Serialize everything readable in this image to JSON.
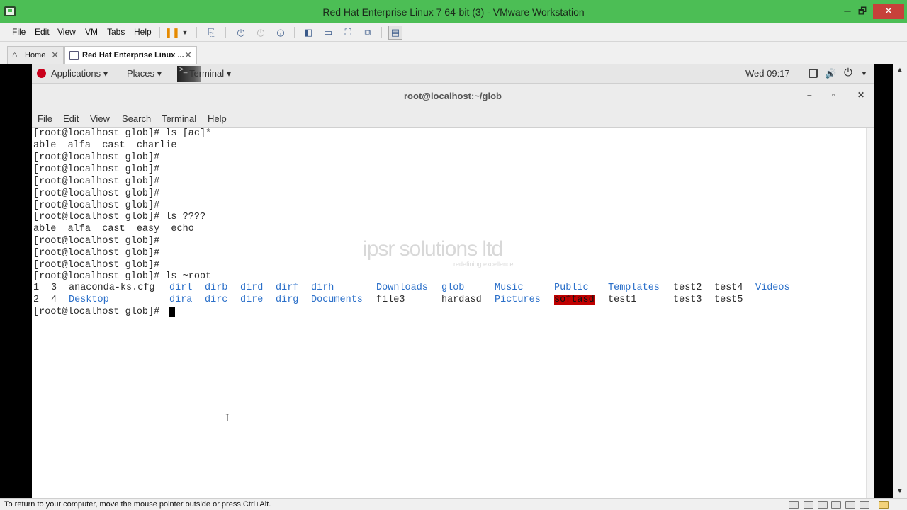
{
  "window": {
    "title": "Red Hat Enterprise Linux 7 64-bit (3) - VMware Workstation",
    "minimize": "─",
    "restore": "🗗",
    "close": "✕"
  },
  "vm_menu": [
    "File",
    "Edit",
    "View",
    "VM",
    "Tabs",
    "Help"
  ],
  "tabs": [
    {
      "label": "Home",
      "close": "✕"
    },
    {
      "label": "Red Hat Enterprise Linux ...",
      "close": "✕"
    }
  ],
  "gnome_panel": {
    "applications": "Applications ▾",
    "places": "Places ▾",
    "terminal": "Terminal ▾",
    "clock": "Wed 09:17",
    "icons": [
      "display-icon",
      "volume-icon",
      "power-icon"
    ]
  },
  "terminal": {
    "title": "root@localhost:~/glob",
    "min": "–",
    "max": "▫",
    "close": "✕",
    "menu": [
      "File",
      "Edit",
      "View",
      "Search",
      "Terminal",
      "Help"
    ],
    "lines": [
      "[root@localhost glob]# ls [ac]*",
      "able  alfa  cast  charlie",
      "[root@localhost glob]#",
      "[root@localhost glob]#",
      "[root@localhost glob]#",
      "[root@localhost glob]#",
      "[root@localhost glob]#",
      "[root@localhost glob]# ls ????",
      "able  alfa  cast  easy  echo",
      "[root@localhost glob]#",
      "[root@localhost glob]#",
      "[root@localhost glob]#",
      "[root@localhost glob]# ls ~root"
    ],
    "listing_row1": [
      {
        "t": "1",
        "k": "file"
      },
      {
        "t": "3",
        "k": "file"
      },
      {
        "t": "anaconda-ks.cfg",
        "k": "file"
      },
      {
        "t": "dirl",
        "k": "dir"
      },
      {
        "t": "dirb",
        "k": "dir"
      },
      {
        "t": "dird",
        "k": "dir"
      },
      {
        "t": "dirf",
        "k": "dir"
      },
      {
        "t": "dirh",
        "k": "dir"
      },
      {
        "t": "Downloads",
        "k": "dir"
      },
      {
        "t": "glob",
        "k": "dir"
      },
      {
        "t": "Music",
        "k": "dir"
      },
      {
        "t": "Public",
        "k": "dir"
      },
      {
        "t": "Templates",
        "k": "dir"
      },
      {
        "t": "test2",
        "k": "file"
      },
      {
        "t": "test4",
        "k": "file"
      },
      {
        "t": "Videos",
        "k": "dir"
      }
    ],
    "listing_row2": [
      {
        "t": "2",
        "k": "file"
      },
      {
        "t": "4",
        "k": "file"
      },
      {
        "t": "Desktop",
        "k": "dir"
      },
      {
        "t": "dira",
        "k": "dir"
      },
      {
        "t": "dirc",
        "k": "dir"
      },
      {
        "t": "dire",
        "k": "dir"
      },
      {
        "t": "dirg",
        "k": "dir"
      },
      {
        "t": "Documents",
        "k": "dir"
      },
      {
        "t": "file3",
        "k": "file"
      },
      {
        "t": "hardasd",
        "k": "file"
      },
      {
        "t": "Pictures",
        "k": "dir"
      },
      {
        "t": "softasd",
        "k": "warn"
      },
      {
        "t": "test1",
        "k": "file"
      },
      {
        "t": "test3",
        "k": "file"
      },
      {
        "t": "test5",
        "k": "file"
      }
    ],
    "prompt": "[root@localhost glob]# "
  },
  "watermark": {
    "text": "ipsr solutions ltd",
    "tagline": "redefining excellence"
  },
  "status": {
    "text": "To return to your computer, move the mouse pointer outside or press Ctrl+Alt."
  },
  "colors": {
    "vm_titlebar": "#4cbe55",
    "dir": "#2a6fc9",
    "warn_bg": "#c00000"
  }
}
